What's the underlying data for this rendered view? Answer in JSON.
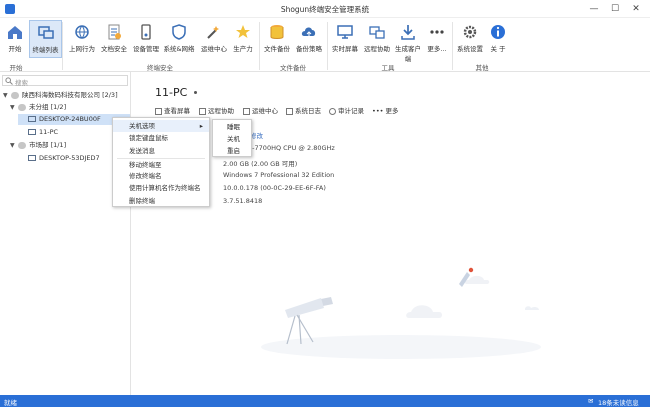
{
  "window": {
    "title": "Shogun终端安全管理系统",
    "controls": [
      "—",
      "☐",
      "✕"
    ]
  },
  "ribbon": {
    "buttons": [
      {
        "label": "开始",
        "icon": "home-icon"
      },
      {
        "label": "终端列表",
        "icon": "terminal-list-icon"
      },
      {
        "label": "上网行为",
        "icon": "web-behavior-icon"
      },
      {
        "label": "文档安全",
        "icon": "document-security-icon"
      },
      {
        "label": "设备管理",
        "icon": "device-management-icon"
      },
      {
        "label": "系统&网络",
        "icon": "system-network-icon"
      },
      {
        "label": "运维中心",
        "icon": "maintenance-center-icon"
      },
      {
        "label": "生产力",
        "icon": "productivity-icon"
      },
      {
        "label": "文件备份",
        "icon": "file-backup-icon"
      },
      {
        "label": "备份策略",
        "icon": "backup-policy-icon"
      },
      {
        "label": "实时屏幕",
        "icon": "live-screen-icon"
      },
      {
        "label": "远程协助",
        "icon": "remote-assist-icon"
      },
      {
        "label": "生成客户端",
        "icon": "generate-client-icon"
      },
      {
        "label": "更多...",
        "icon": "more-icon"
      },
      {
        "label": "系统设置",
        "icon": "settings-icon"
      },
      {
        "label": "关 于",
        "icon": "about-icon"
      }
    ],
    "groups": [
      "开始",
      "终端安全",
      "文件备份",
      "工具",
      "其他"
    ]
  },
  "sidebar": {
    "search_placeholder": "搜索",
    "tree": [
      {
        "label": "陕西科海数码科技有限公司 [2/3]",
        "caret": "▼",
        "icon": "group-icon"
      },
      {
        "label": "未分组 [1/2]",
        "caret": "▼",
        "icon": "group-icon"
      },
      {
        "label": "DESKTOP-24BU00F",
        "caret": "",
        "icon": "computer-icon"
      },
      {
        "label": "11-PC",
        "caret": "",
        "icon": "computer-icon"
      },
      {
        "label": "市场部 [1/1]",
        "caret": "▼",
        "icon": "group-icon"
      },
      {
        "label": "DESKTOP-53DJED7",
        "caret": "",
        "icon": "computer-icon"
      }
    ]
  },
  "main": {
    "hostname": "11-PC",
    "toolbar": [
      "查看屏幕",
      "远程协助",
      "运维中心",
      "系统日志",
      "审计记录",
      "更多"
    ],
    "info": {
      "edit_link": "修改",
      "cpu": "re(TM) i7-7700HQ CPU @ 2.80GHz",
      "memory": "2.00 GB (2.00 GB 可用)",
      "os": "Windows 7 Professional 32 Edition",
      "network": "10.0.0.178  (00-0C-29-EE-6F-FA)",
      "version": "3.7.51.8418"
    }
  },
  "context_menu": {
    "items": [
      "关机选项",
      "锁定键盘鼠标",
      "发送消息",
      "移动终端至",
      "修改终端名",
      "使用计算机名作为终端名",
      "删除终端"
    ],
    "submenu_arrow": "▸"
  },
  "submenu": {
    "items": [
      "睡眠",
      "关机",
      "重启"
    ]
  },
  "statusbar": {
    "left": "就绪",
    "right": "18条未读信息"
  },
  "colors": {
    "accent": "#2a6fd6",
    "selection": "#cfe1f7",
    "status_online": "#3a8ee6",
    "rocket_flame": "#e0533a"
  }
}
